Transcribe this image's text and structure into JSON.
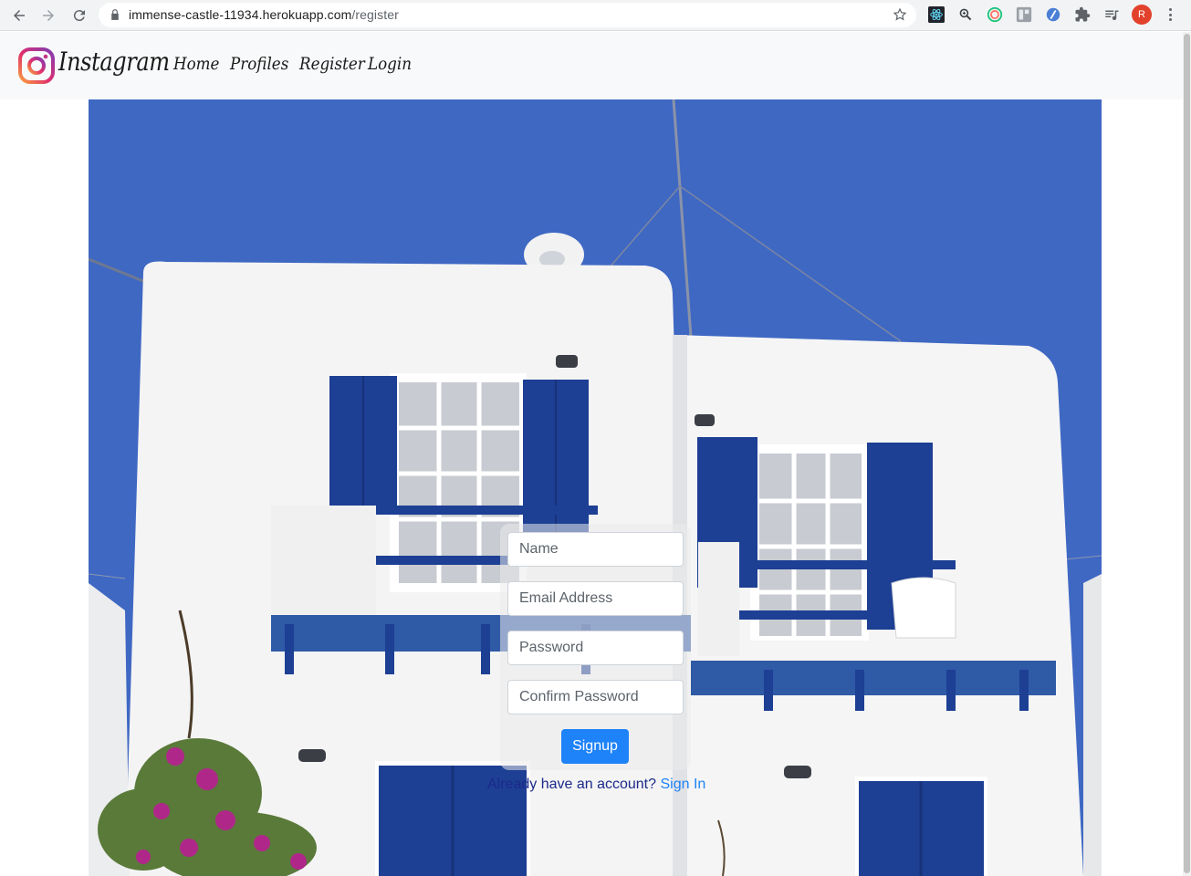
{
  "browser": {
    "url_host": "immense-castle-11934.herokuapp.com",
    "url_path": "/register",
    "profile_initial": "R"
  },
  "navbar": {
    "brand": "Instagram",
    "links": [
      "Home",
      "Profiles",
      "Register",
      "Login"
    ]
  },
  "form": {
    "name_placeholder": "Name",
    "email_placeholder": "Email Address",
    "password_placeholder": "Password",
    "confirm_placeholder": "Confirm Password",
    "submit_label": "Signup",
    "signin_prompt": "Already have an account?",
    "signin_link": "Sign In"
  },
  "colors": {
    "primary": "#1e82f8",
    "sky": "#3f68c3",
    "shutter_blue": "#1d3f94",
    "navbar_bg": "#f8f9fa"
  },
  "icons": [
    "back-icon",
    "forward-icon",
    "reload-icon",
    "lock-icon",
    "bookmark-star-icon",
    "react-devtools-icon",
    "zoom-icon",
    "extension-icon",
    "puzzle-icon",
    "media-control-icon",
    "more-icon"
  ]
}
